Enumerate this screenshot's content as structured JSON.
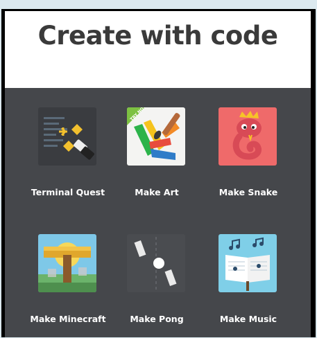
{
  "page": {
    "title": "Create with code"
  },
  "apps": [
    {
      "label": "Terminal Quest",
      "icon": "terminal-quest-icon"
    },
    {
      "label": "Make Art",
      "icon": "make-art-icon",
      "badge": "TRY NOW"
    },
    {
      "label": "Make Snake",
      "icon": "make-snake-icon"
    },
    {
      "label": "Make Minecraft",
      "icon": "make-minecraft-icon"
    },
    {
      "label": "Make Pong",
      "icon": "make-pong-icon"
    },
    {
      "label": "Make Music",
      "icon": "make-music-icon"
    }
  ],
  "colors": {
    "background": "#dce9ef",
    "panel": "#45474b",
    "header": "#ffffff",
    "title": "#3a3a3a",
    "label": "#ffffff"
  }
}
